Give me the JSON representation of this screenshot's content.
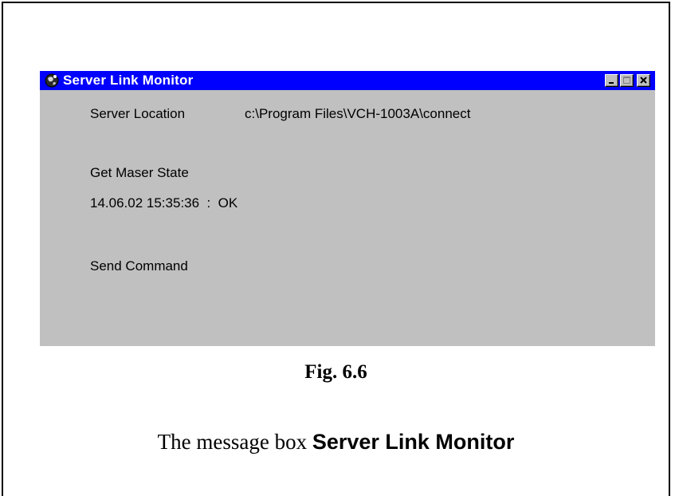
{
  "window": {
    "title": "Server Link Monitor",
    "icon": "globe-icon",
    "controls": [
      "minimize-icon",
      "maximize-icon",
      "close-icon"
    ],
    "titlebar_color": "#0000FE",
    "body_color": "#C0C0C0"
  },
  "fields": {
    "server_location_label": "Server Location",
    "server_location_value": "c:\\Program Files\\VCH-1003A\\connect",
    "get_state_label": "Get Maser State",
    "state_status": "14.06.02 15:35:36  :  OK",
    "send_command_label": "Send Command"
  },
  "caption": {
    "figure": "Fig. 6.6",
    "prefix": "The message box ",
    "bold": "Server Link Monitor"
  }
}
